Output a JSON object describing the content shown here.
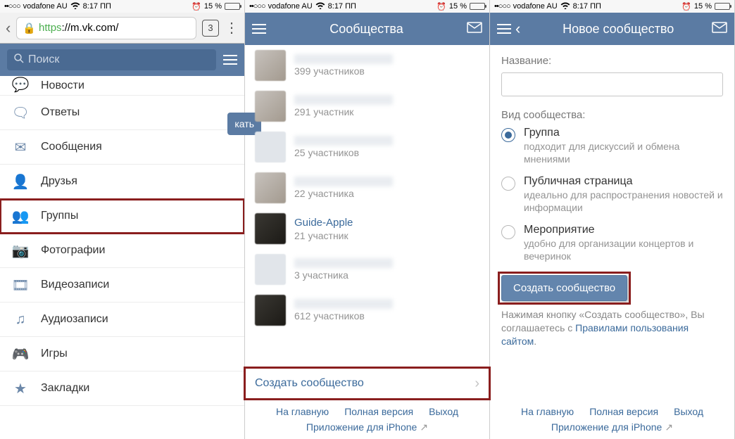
{
  "status": {
    "carrier": "vodafone AU",
    "time": "8:17 ПП",
    "battery_pct": "15 %",
    "signal_dots": "••○○○"
  },
  "pane1": {
    "url_https": "https",
    "url_rest": "://m.vk.com/",
    "tabs_count": "3",
    "search_placeholder": "Поиск",
    "peek_label": "кать",
    "menu": [
      {
        "label": "Новости",
        "icon": "chat-icon"
      },
      {
        "label": "Ответы",
        "icon": "reply-icon"
      },
      {
        "label": "Сообщения",
        "icon": "mail-icon"
      },
      {
        "label": "Друзья",
        "icon": "person-icon"
      },
      {
        "label": "Группы",
        "icon": "people-icon"
      },
      {
        "label": "Фотографии",
        "icon": "camera-icon"
      },
      {
        "label": "Видеозаписи",
        "icon": "video-icon"
      },
      {
        "label": "Аудиозаписи",
        "icon": "music-icon"
      },
      {
        "label": "Игры",
        "icon": "gamepad-icon"
      },
      {
        "label": "Закладки",
        "icon": "star-icon"
      }
    ]
  },
  "pane2": {
    "title": "Сообщества",
    "items": [
      {
        "sub": "399 участников"
      },
      {
        "sub": "291 участник"
      },
      {
        "sub": "25 участников"
      },
      {
        "sub": "22 участника"
      },
      {
        "name": "Guide-Apple",
        "sub": "21 участник"
      },
      {
        "sub": "3 участника"
      },
      {
        "sub": "612 участников"
      }
    ],
    "create_label": "Создать сообщество"
  },
  "pane3": {
    "title": "Новое сообщество",
    "name_label": "Название:",
    "type_label": "Вид сообщества:",
    "options": [
      {
        "title": "Группа",
        "sub": "подходит для дискуссий и обмена мнениями"
      },
      {
        "title": "Публичная страница",
        "sub": "идеально для распространения новостей и информации"
      },
      {
        "title": "Мероприятие",
        "sub": "удобно для организации концертов и вечеринок"
      }
    ],
    "create_btn": "Создать сообщество",
    "agree_pre": "Нажимая кнопку «Создать сообщество», Вы соглашаетесь с ",
    "agree_link": "Правилами пользования сайтом",
    "agree_post": "."
  },
  "footer": {
    "home": "На главную",
    "full": "Полная версия",
    "logout": "Выход",
    "app": "Приложение для iPhone"
  }
}
